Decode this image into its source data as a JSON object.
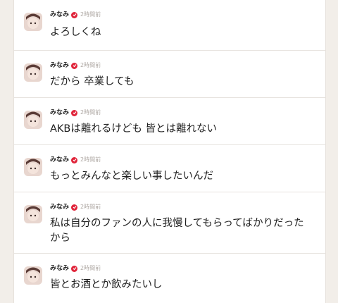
{
  "posts": [
    {
      "author": "みなみ",
      "time": "2時間前",
      "text": "よろしくね"
    },
    {
      "author": "みなみ",
      "time": "2時間前",
      "text": "だから 卒業しても"
    },
    {
      "author": "みなみ",
      "time": "2時間前",
      "text": "AKBは離れるけども 皆とは離れない"
    },
    {
      "author": "みなみ",
      "time": "2時間前",
      "text": "もっとみんなと楽しい事したいんだ"
    },
    {
      "author": "みなみ",
      "time": "2時間前",
      "text": "私は自分のファンの人に我慢してもらってばかりだったから"
    },
    {
      "author": "みなみ",
      "time": "2時間前",
      "text": "皆とお酒とか飲みたいし"
    }
  ],
  "colors": {
    "accent": "#e0243a",
    "time": "#b0aaa5",
    "background": "#f2eee9"
  },
  "icons": {
    "verified": "verified-check-icon"
  }
}
